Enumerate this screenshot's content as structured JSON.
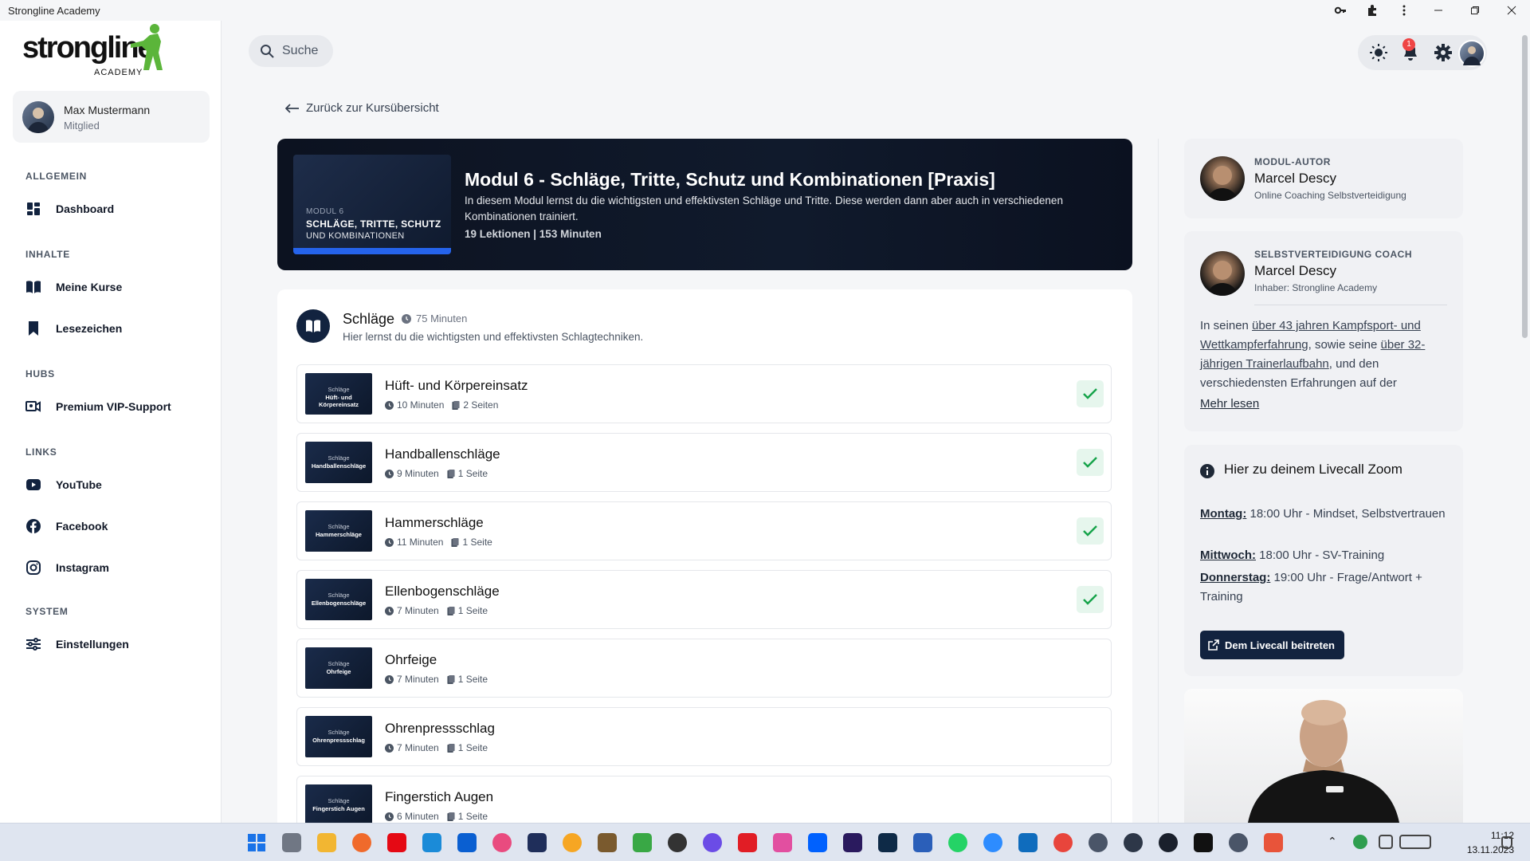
{
  "window": {
    "title": "Strongline Academy"
  },
  "user": {
    "name": "Max Mustermann",
    "role": "Mitglied"
  },
  "nav": {
    "sections": {
      "allgemein": "ALLGEMEIN",
      "inhalte": "INHALTE",
      "hubs": "HUBS",
      "links": "LINKS",
      "system": "SYSTEM"
    },
    "items": {
      "dashboard": "Dashboard",
      "courses": "Meine Kurse",
      "bookmarks": "Lesezeichen",
      "support": "Premium VIP-Support",
      "youtube": "YouTube",
      "facebook": "Facebook",
      "instagram": "Instagram",
      "settings": "Einstellungen"
    }
  },
  "header": {
    "search_label": "Suche",
    "notification_count": "1"
  },
  "back_link": "Zurück zur Kursübersicht",
  "module": {
    "thumb_line1": "MODUL 6",
    "thumb_line2": "SCHLÄGE, TRITTE, SCHUTZ",
    "thumb_line3": "UND KOMBINATIONEN",
    "title": "Modul 6 - Schläge, Tritte, Schutz und Kombinationen [Praxis]",
    "description": "In diesem Modul lernst du die wichtigsten und effektivsten Schläge und Tritte. Diese werden dann aber auch in verschiedenen Kombinationen trainiert.",
    "meta": "19 Lektionen | 153 Minuten"
  },
  "section": {
    "title": "Schläge",
    "duration": "75 Minuten",
    "description": "Hier lernst du die wichtigsten und effektivsten Schlagtechniken."
  },
  "lessons": [
    {
      "thumb_top": "Schläge",
      "thumb_bottom": "Hüft- und Körpereinsatz",
      "title": "Hüft- und Körpereinsatz",
      "duration": "10 Minuten",
      "pages": "2 Seiten",
      "completed": true
    },
    {
      "thumb_top": "Schläge",
      "thumb_bottom": "Handballenschläge",
      "title": "Handballenschläge",
      "duration": "9 Minuten",
      "pages": "1 Seite",
      "completed": true
    },
    {
      "thumb_top": "Schläge",
      "thumb_bottom": "Hammerschläge",
      "title": "Hammerschläge",
      "duration": "11 Minuten",
      "pages": "1 Seite",
      "completed": true
    },
    {
      "thumb_top": "Schläge",
      "thumb_bottom": "Ellenbogenschläge",
      "title": "Ellenbogenschläge",
      "duration": "7 Minuten",
      "pages": "1 Seite",
      "completed": true
    },
    {
      "thumb_top": "Schläge",
      "thumb_bottom": "Ohrfeige",
      "title": "Ohrfeige",
      "duration": "7 Minuten",
      "pages": "1 Seite",
      "completed": false
    },
    {
      "thumb_top": "Schläge",
      "thumb_bottom": "Ohrenpressschlag",
      "title": "Ohrenpressschlag",
      "duration": "7 Minuten",
      "pages": "1 Seite",
      "completed": false
    },
    {
      "thumb_top": "Schläge",
      "thumb_bottom": "Fingerstich Augen",
      "title": "Fingerstich Augen",
      "duration": "6 Minuten",
      "pages": "1 Seite",
      "completed": false
    }
  ],
  "author": {
    "label": "MODUL-AUTOR",
    "name": "Marcel Descy",
    "subtitle": "Online Coaching Selbstverteidigung"
  },
  "coach": {
    "label": "SELBSTVERTEIDIGUNG COACH",
    "name": "Marcel Descy",
    "subtitle": "Inhaber: Strongline Academy",
    "bio_1": "In seinen ",
    "bio_link1": "über 43 jahren Kampfsport- und Wettkampferfahrung",
    "bio_2": ", sowie seine ",
    "bio_link2": "über 32-jährigen Trainerlaufbahn",
    "bio_3": ", und den verschiedensten Erfahrungen auf der",
    "more": "Mehr lesen"
  },
  "livecall": {
    "title": "Hier zu deinem Livecall Zoom",
    "schedule": [
      {
        "day": "Montag:",
        "text": " 18:00 Uhr - Mindset, Selbstvertrauen"
      },
      {
        "day": "Mittwoch:",
        "text": " 18:00 Uhr - SV-Training"
      },
      {
        "day": "Donnerstag:",
        "text": " 19:00 Uhr - Frage/Antwort + Training"
      }
    ],
    "button": "Dem Livecall beitreten"
  },
  "taskbar": {
    "time": "11:12",
    "date": "13.11.2023"
  },
  "colors": {
    "accent": "#12233f",
    "success": "#16a34a",
    "badge": "#ef4444",
    "brand_green": "#5bb53a"
  }
}
